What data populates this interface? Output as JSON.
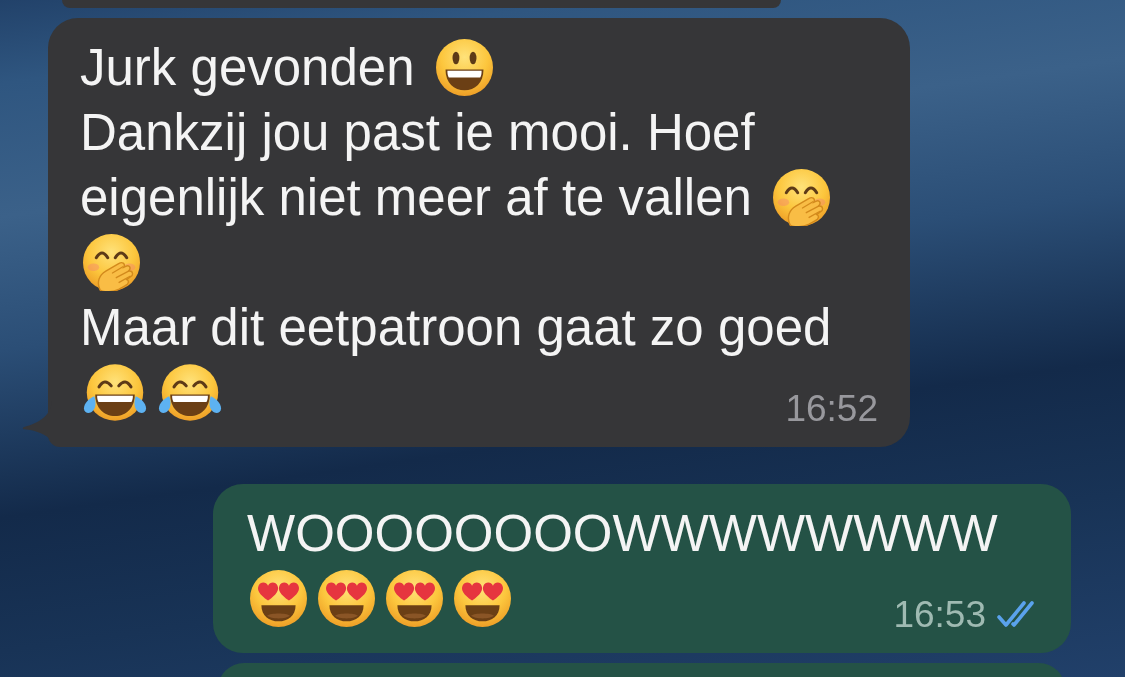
{
  "messages": [
    {
      "kind": "stub-top",
      "outgoing": false
    },
    {
      "kind": "bubble",
      "outgoing": false,
      "tail": true,
      "lines": [
        [
          {
            "kind": "text",
            "text": "Jurk gevonden"
          },
          {
            "kind": "smiley"
          }
        ],
        [
          {
            "kind": "text",
            "text": "Dankzij jou past ie mooi. Hoef"
          }
        ],
        [
          {
            "kind": "text",
            "text": "eigenlijk niet meer af te vallen"
          },
          {
            "kind": "hand-over-mouth"
          }
        ],
        [
          {
            "kind": "hand-over-mouth"
          }
        ],
        [
          {
            "kind": "text",
            "text": "Maar dit eetpatroon gaat zo goed"
          }
        ],
        [
          {
            "kind": "tears-of-joy"
          },
          {
            "kind": "tears-of-joy"
          }
        ]
      ],
      "time": "16:52"
    },
    {
      "kind": "bubble",
      "outgoing": true,
      "tail": false,
      "lines": [
        [
          {
            "kind": "text",
            "text": "WOOOOOOOOWWWWWWWW"
          }
        ],
        [
          {
            "kind": "heart-eyes"
          },
          {
            "kind": "heart-eyes"
          },
          {
            "kind": "heart-eyes"
          },
          {
            "kind": "heart-eyes"
          }
        ]
      ],
      "time": "16:53",
      "read": true
    },
    {
      "kind": "stub-bottom",
      "outgoing": true
    }
  ]
}
